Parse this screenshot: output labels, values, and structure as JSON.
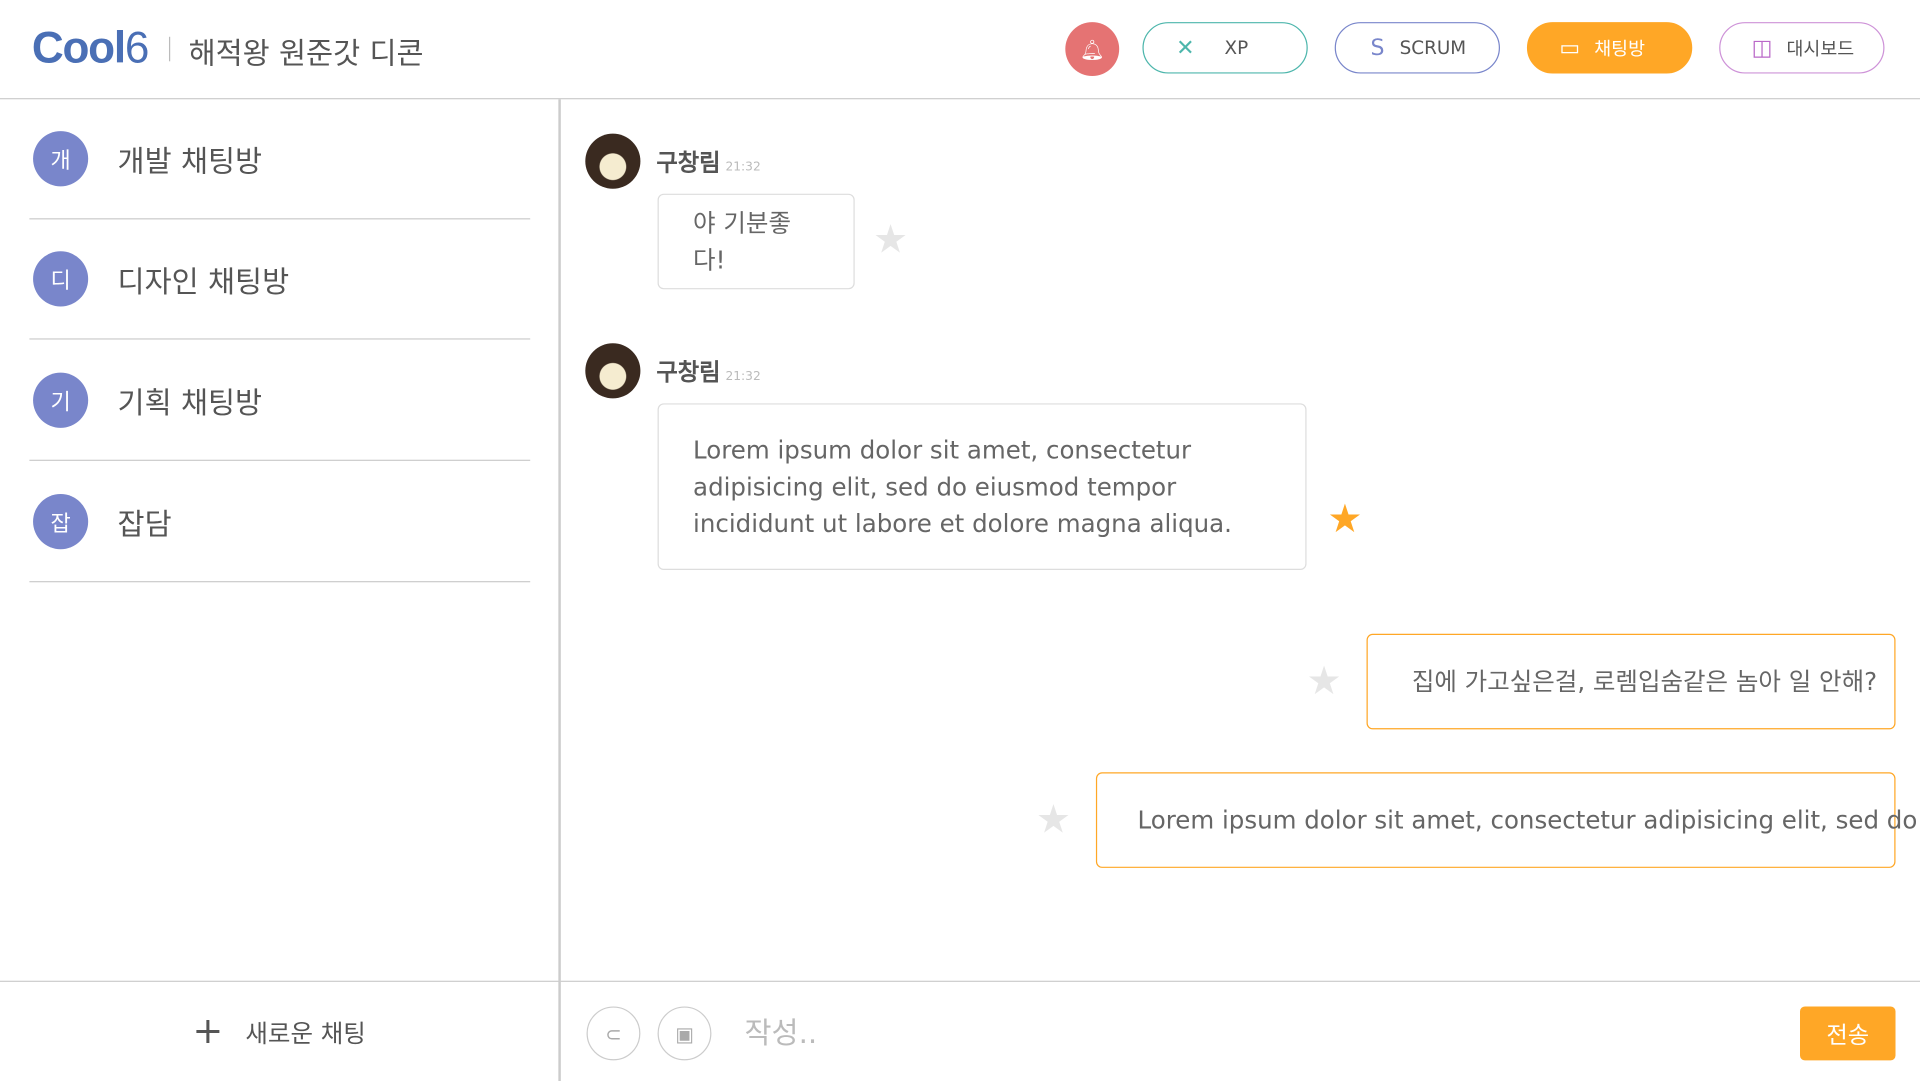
{
  "header": {
    "logo_main": "Cool",
    "logo_num": "6",
    "project_title": "해적왕 원준갓 디콘",
    "nav": [
      {
        "label": "XP",
        "icon": "xp-icon",
        "color": "#4db6ac"
      },
      {
        "label": "SCRUM",
        "icon": "scrum-icon",
        "color": "#7986cb"
      },
      {
        "label": "채팅방",
        "icon": "chat-icon",
        "color": "#ffa726",
        "active": true
      },
      {
        "label": "대시보드",
        "icon": "dashboard-icon",
        "color": "#ce93d8"
      }
    ],
    "bell_color": "#e57373"
  },
  "sidebar": {
    "rooms": [
      {
        "initial": "개",
        "name": "개발 채팅방"
      },
      {
        "initial": "디",
        "name": "디자인 채팅방"
      },
      {
        "initial": "기",
        "name": "기획 채팅방"
      },
      {
        "initial": "잡",
        "name": "잡담"
      }
    ],
    "new_chat_label": "새로운 채팅"
  },
  "messages": [
    {
      "sender": "구창림",
      "time": "21:32",
      "text": "야 기분좋다!",
      "starred": false,
      "mine": false
    },
    {
      "sender": "구창림",
      "time": "21:32",
      "text": "Lorem ipsum dolor sit amet, consectetur adipisicing elit, sed do eiusmod tempor incididunt ut labore et dolore magna aliqua.",
      "starred": true,
      "mine": false
    },
    {
      "text": "집에 가고싶은걸, 로렘입숨같은 놈아 일 안해?",
      "starred": false,
      "mine": true
    },
    {
      "text": "Lorem ipsum dolor sit amet, consectetur adipisicing elit, sed do",
      "starred": false,
      "mine": true
    }
  ],
  "composer": {
    "placeholder": "작성..",
    "send_label": "전송"
  }
}
